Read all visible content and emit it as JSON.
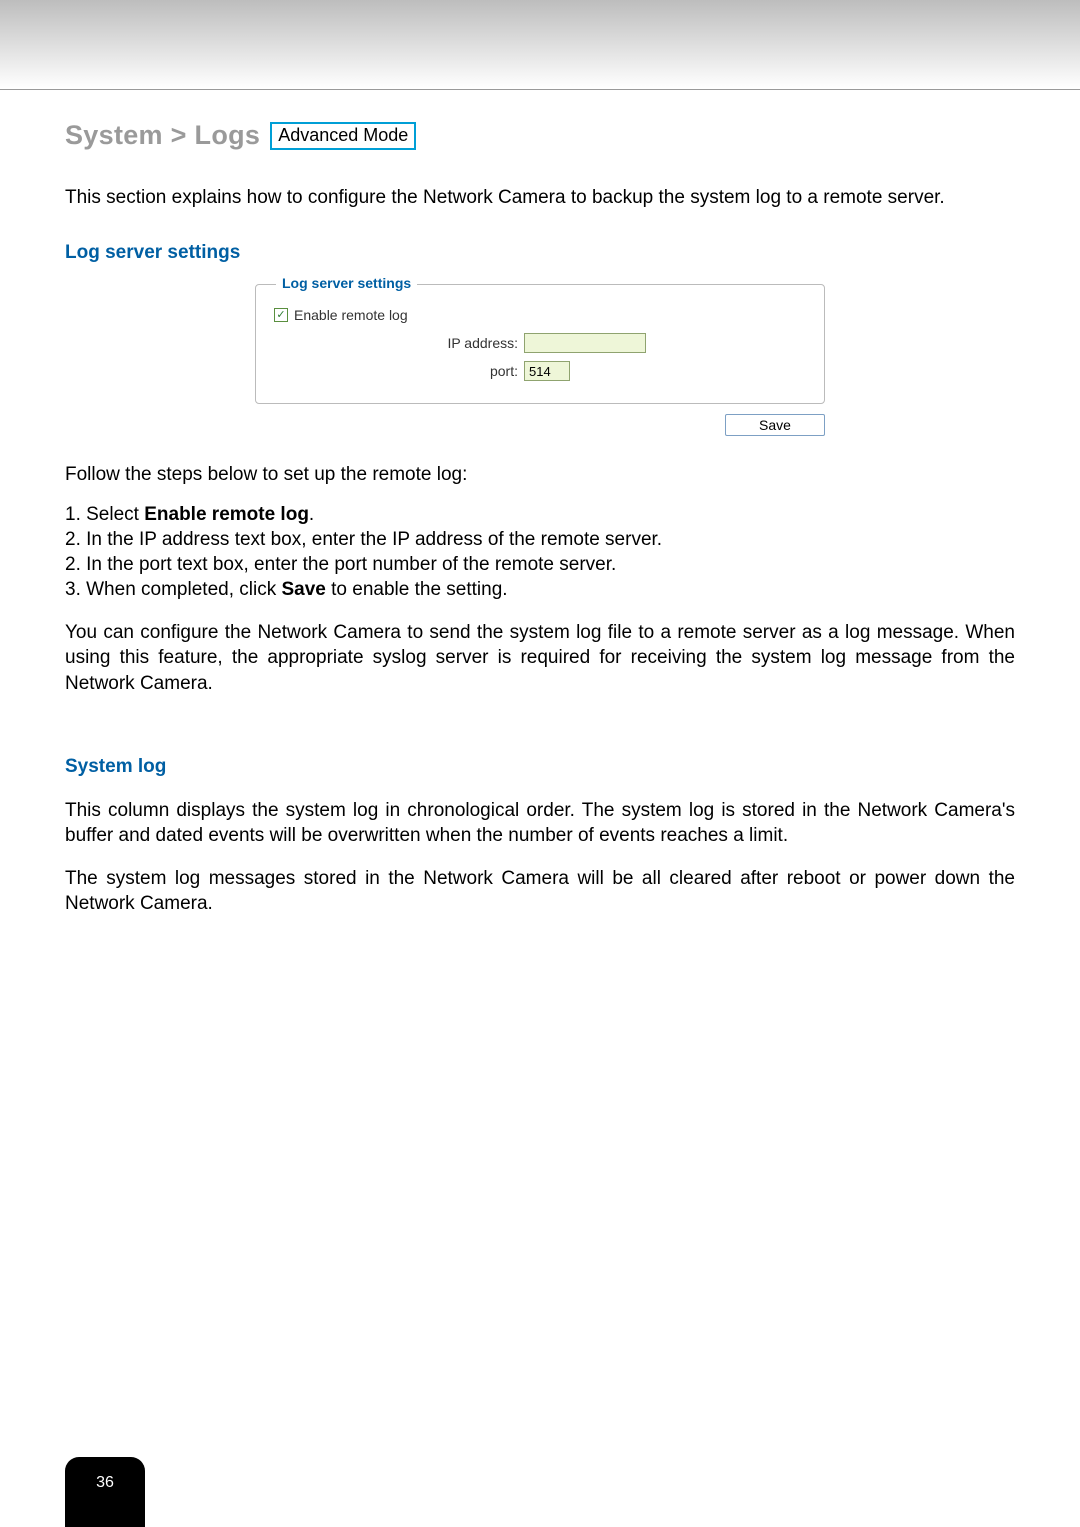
{
  "breadcrumb": "System > Logs",
  "mode_badge": "Advanced Mode",
  "intro": "This section explains how to configure the Network Camera to backup the system log to a remote server.",
  "sections": {
    "log_server": {
      "heading": "Log server settings",
      "fieldset_legend": "Log server settings",
      "enable_checkbox": {
        "label": "Enable remote log",
        "checked": true
      },
      "ip": {
        "label": "IP address:",
        "value": ""
      },
      "port": {
        "label": "port:",
        "value": "514"
      },
      "save_button": "Save",
      "steps_intro": "Follow the steps below to set up the remote log:",
      "steps": [
        {
          "prefix": "1. Select ",
          "bold": "Enable remote log",
          "suffix": "."
        },
        {
          "prefix": "2. In the IP address text box, enter the IP address of the remote server.",
          "bold": "",
          "suffix": ""
        },
        {
          "prefix": "2. In the port text box, enter the port number of the remote server.",
          "bold": "",
          "suffix": ""
        },
        {
          "prefix": "3. When completed, click ",
          "bold": "Save",
          "suffix": " to enable the setting."
        }
      ],
      "note": "You can configure the Network Camera to send the system log file to a remote server as a log message. When using this feature, the appropriate syslog server is required for receiving the system log message from the Network Camera."
    },
    "system_log": {
      "heading": "System log",
      "para1": "This column displays the system log in chronological order. The system log is stored in the Network Camera's buffer and dated events will be overwritten when the number of events reaches a limit.",
      "para2": "The system log messages stored in the Network Camera will be all cleared after reboot or power down the Network Camera."
    }
  },
  "page_number": "36"
}
